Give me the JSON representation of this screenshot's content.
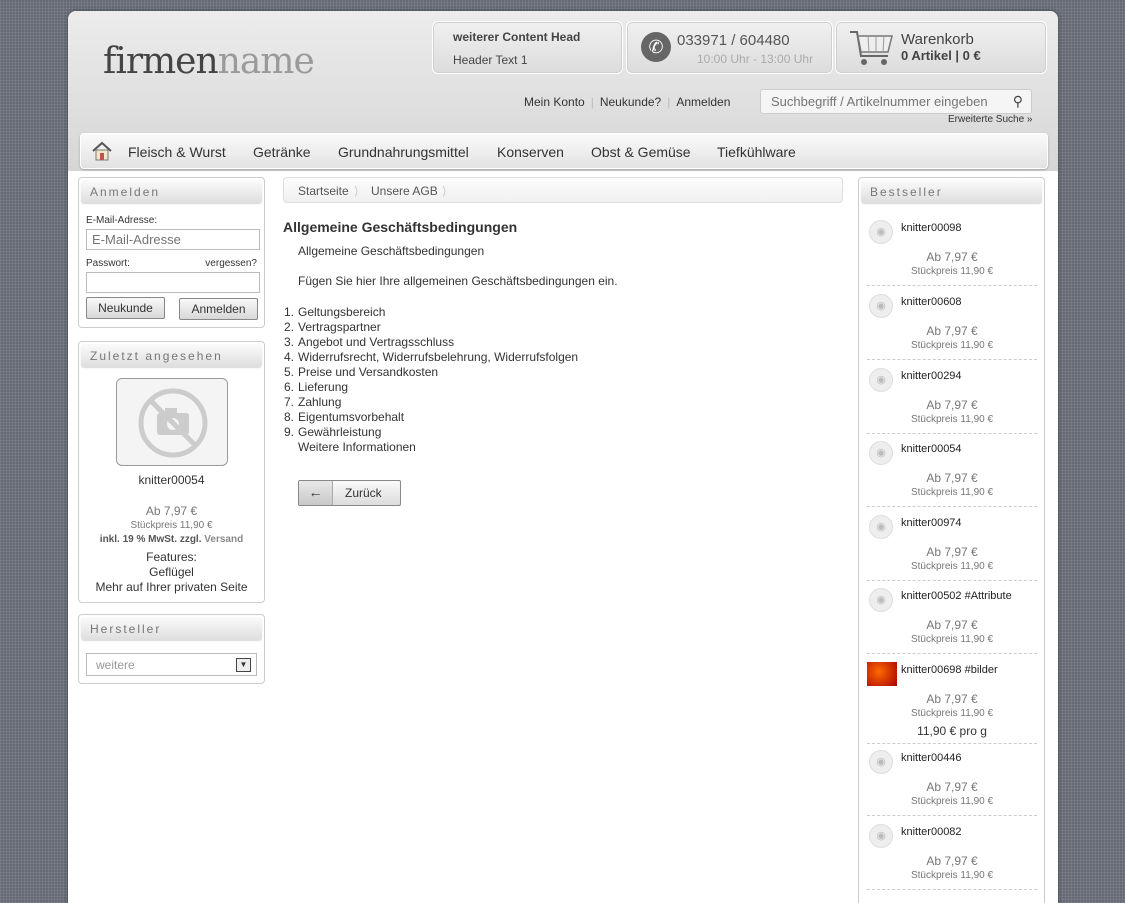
{
  "logo": {
    "part1": "firmen",
    "part2": "name"
  },
  "header": {
    "content_head": "weiterer Content Head",
    "content_text": "Header Text 1",
    "phone": "033971 / 604480",
    "hours": "10:00 Uhr - 13:00 Uhr",
    "cart_title": "Warenkorb",
    "cart_summary": "0 Artikel | 0 €"
  },
  "toplinks": [
    "Mein Konto",
    "Neukunde?",
    "Anmelden"
  ],
  "search": {
    "placeholder": "Suchbegriff / Artikelnummer eingeben",
    "advanced": "Erweiterte Suche »"
  },
  "nav": [
    "Fleisch & Wurst",
    "Getränke",
    "Grundnahrungsmittel",
    "Konserven",
    "Obst & Gemüse",
    "Tiefkühlware"
  ],
  "login": {
    "title": "Anmelden",
    "email_label": "E-Mail-Adresse:",
    "email_placeholder": "E-Mail-Adresse",
    "password_label": "Passwort:",
    "forgot": "vergessen?",
    "new_customer": "Neukunde",
    "login_button": "Anmelden"
  },
  "recent": {
    "title": "Zuletzt angesehen",
    "name": "knitter00054",
    "price": "Ab 7,97 €",
    "unit_price": "Stückpreis 11,90 €",
    "tax_prefix": "inkl. 19 % MwSt. zzgl.",
    "tax_link": "Versand",
    "features_label": "Features:",
    "feature": "Geflügel",
    "more": "Mehr auf Ihrer privaten Seite"
  },
  "manufacturer": {
    "title": "Hersteller",
    "selected": "weitere"
  },
  "breadcrumb": [
    "Startseite",
    "Unsere AGB"
  ],
  "main": {
    "title": "Allgemeine Geschäftsbedingungen",
    "subtitle": "Allgemeine Geschäftsbedingungen",
    "intro": "Fügen Sie hier Ihre allgemeinen Geschäftsbedingungen ein.",
    "list": [
      "Geltungsbereich",
      "Vertragspartner",
      "Angebot und Vertragsschluss",
      "Widerrufsrecht, Widerrufsbelehrung, Widerrufsfolgen",
      "Preise und Versandkosten",
      "Lieferung",
      "Zahlung",
      "Eigentumsvorbehalt",
      "Gewährleistung"
    ],
    "extra": "Weitere Informationen",
    "back": "Zurück"
  },
  "bestseller": {
    "title": "Bestseller",
    "items": [
      {
        "name": "knitter00098",
        "price": "Ab 7,97 €",
        "unit": "Stückpreis 11,90 €"
      },
      {
        "name": "knitter00608",
        "price": "Ab 7,97 €",
        "unit": "Stückpreis 11,90 €"
      },
      {
        "name": "knitter00294",
        "price": "Ab 7,97 €",
        "unit": "Stückpreis 11,90 €"
      },
      {
        "name": "knitter00054",
        "price": "Ab 7,97 €",
        "unit": "Stückpreis 11,90 €"
      },
      {
        "name": "knitter00974",
        "price": "Ab 7,97 €",
        "unit": "Stückpreis 11,90 €"
      },
      {
        "name": "knitter00502 #Attribute",
        "price": "Ab 7,97 €",
        "unit": "Stückpreis 11,90 €"
      },
      {
        "name": "knitter00698 #bilder",
        "price": "Ab 7,97 €",
        "unit": "Stückpreis 11,90 €",
        "extra": "11,90 € pro g"
      },
      {
        "name": "knitter00446",
        "price": "Ab 7,97 €",
        "unit": "Stückpreis 11,90 €"
      },
      {
        "name": "knitter00082",
        "price": "Ab 7,97 €",
        "unit": "Stückpreis 11,90 €"
      }
    ]
  }
}
